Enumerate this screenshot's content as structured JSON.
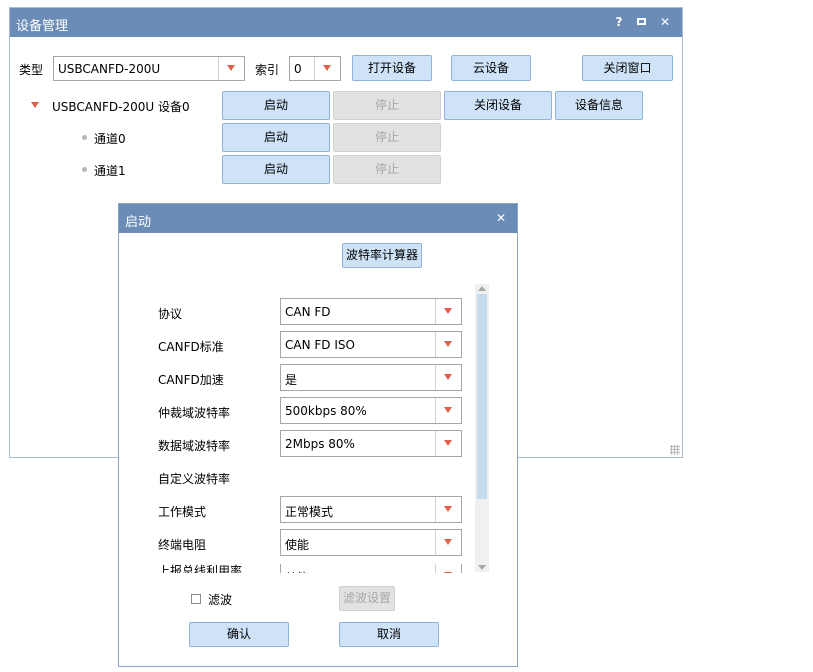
{
  "main_window": {
    "title": "设备管理",
    "help_label": "?",
    "maximize_label": "□",
    "close_label": "✕",
    "type_label": "类型",
    "type_value": "USBCANFD-200U",
    "index_label": "索引",
    "index_value": "0",
    "open_device_label": "打开设备",
    "cloud_device_label": "云设备",
    "close_window_label": "关闭窗口"
  },
  "device_tree": {
    "device_label": "USBCANFD-200U 设备0",
    "start_label": "启动",
    "stop_label": "停止",
    "close_device_label": "关闭设备",
    "device_info_label": "设备信息",
    "channels": [
      {
        "label": "通道0",
        "start_label": "启动",
        "stop_label": "停止"
      },
      {
        "label": "通道1",
        "start_label": "启动",
        "stop_label": "停止"
      }
    ]
  },
  "dialog": {
    "title": "启动",
    "close_label": "✕",
    "baud_calc_label": "波特率计算器",
    "fields": [
      {
        "label": "协议",
        "value": "CAN FD"
      },
      {
        "label": "CANFD标准",
        "value": "CAN FD ISO"
      },
      {
        "label": "CANFD加速",
        "value": "是"
      },
      {
        "label": "仲裁域波特率",
        "value": "500kbps 80%"
      },
      {
        "label": "数据域波特率",
        "value": "2Mbps 80%"
      },
      {
        "label": "自定义波特率",
        "value": ""
      },
      {
        "label": "工作模式",
        "value": "正常模式"
      },
      {
        "label": "终端电阻",
        "value": "使能"
      },
      {
        "label": "上报总线利用率",
        "value": "禁能"
      }
    ],
    "filter_label": "滤波",
    "filter_settings_label": "滤波设置",
    "confirm_label": "确认",
    "cancel_label": "取消"
  }
}
